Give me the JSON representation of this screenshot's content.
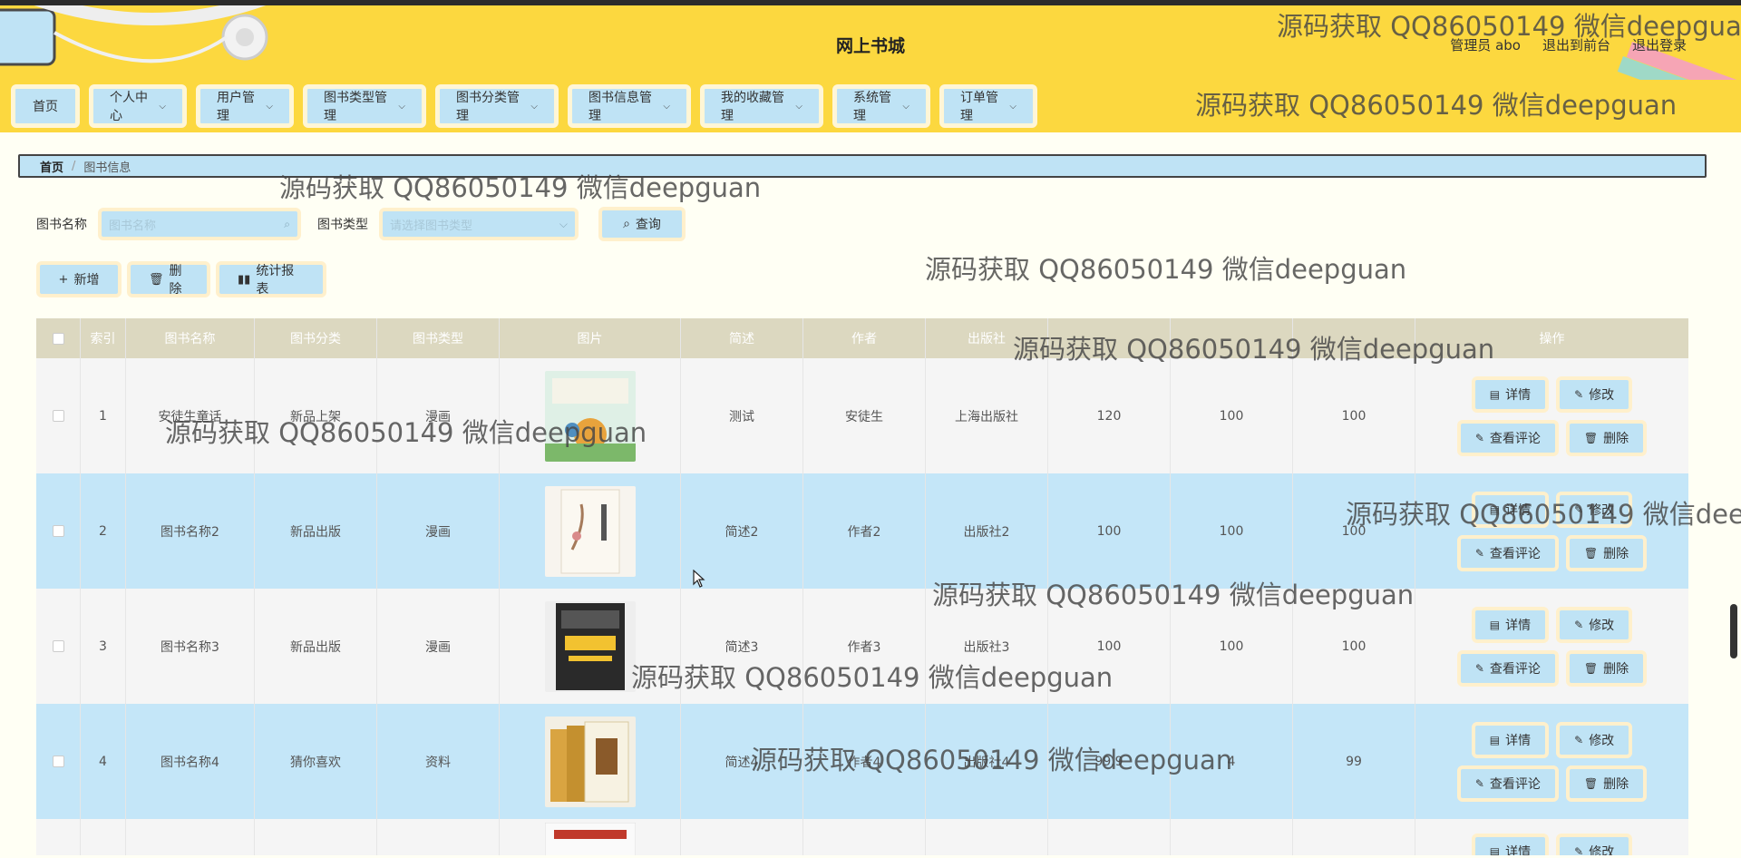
{
  "header": {
    "title": "网上书城",
    "user_label": "管理员 abo",
    "to_front": "退出到前台",
    "logout": "退出登录"
  },
  "nav": [
    {
      "label": "首页",
      "caret": false
    },
    {
      "label": "个人中心",
      "caret": true
    },
    {
      "label": "用户管理",
      "caret": true
    },
    {
      "label": "图书类型管理",
      "caret": true
    },
    {
      "label": "图书分类管理",
      "caret": true
    },
    {
      "label": "图书信息管理",
      "caret": true
    },
    {
      "label": "我的收藏管理",
      "caret": true
    },
    {
      "label": "系统管理",
      "caret": true
    },
    {
      "label": "订单管理",
      "caret": true
    }
  ],
  "breadcrumb": {
    "home": "首页",
    "sep": "/",
    "current": "图书信息"
  },
  "search": {
    "name_label": "图书名称",
    "name_placeholder": "图书名称",
    "type_label": "图书类型",
    "type_placeholder": "请选择图书类型",
    "query_label": "查询"
  },
  "actions": {
    "add": "新增",
    "delete": "删除",
    "report": "统计报表"
  },
  "table": {
    "columns": [
      "索引",
      "图书名称",
      "图书分类",
      "图书类型",
      "图片",
      "简述",
      "作者",
      "出版社",
      "",
      "",
      "",
      "操作"
    ],
    "rows": [
      {
        "index": "1",
        "name": "安徒生童话",
        "category": "新品上架",
        "type": "漫画",
        "desc": "测试",
        "author": "安徒生",
        "publisher": "上海出版社",
        "c1": "120",
        "c2": "100",
        "c3": "100"
      },
      {
        "index": "2",
        "name": "图书名称2",
        "category": "新品出版",
        "type": "漫画",
        "desc": "简述2",
        "author": "作者2",
        "publisher": "出版社2",
        "c1": "100",
        "c2": "100",
        "c3": "100"
      },
      {
        "index": "3",
        "name": "图书名称3",
        "category": "新品出版",
        "type": "漫画",
        "desc": "简述3",
        "author": "作者3",
        "publisher": "出版社3",
        "c1": "100",
        "c2": "100",
        "c3": "100"
      },
      {
        "index": "4",
        "name": "图书名称4",
        "category": "猜你喜欢",
        "type": "资料",
        "desc": "简述4",
        "author": "作者4",
        "publisher": "出版社4",
        "c1": "99.9",
        "c2": "4",
        "c3": "99"
      }
    ],
    "ops": {
      "detail": "详情",
      "edit": "修改",
      "comments": "查看评论",
      "delete": "删除"
    }
  },
  "watermark": "源码获取 QQ86050149 微信deepguan",
  "colors": {
    "header_bg": "#fcd83f",
    "button_bg": "#bfe3f5",
    "button_border": "#fff0cc",
    "row_alt": "#c4e6f8"
  }
}
